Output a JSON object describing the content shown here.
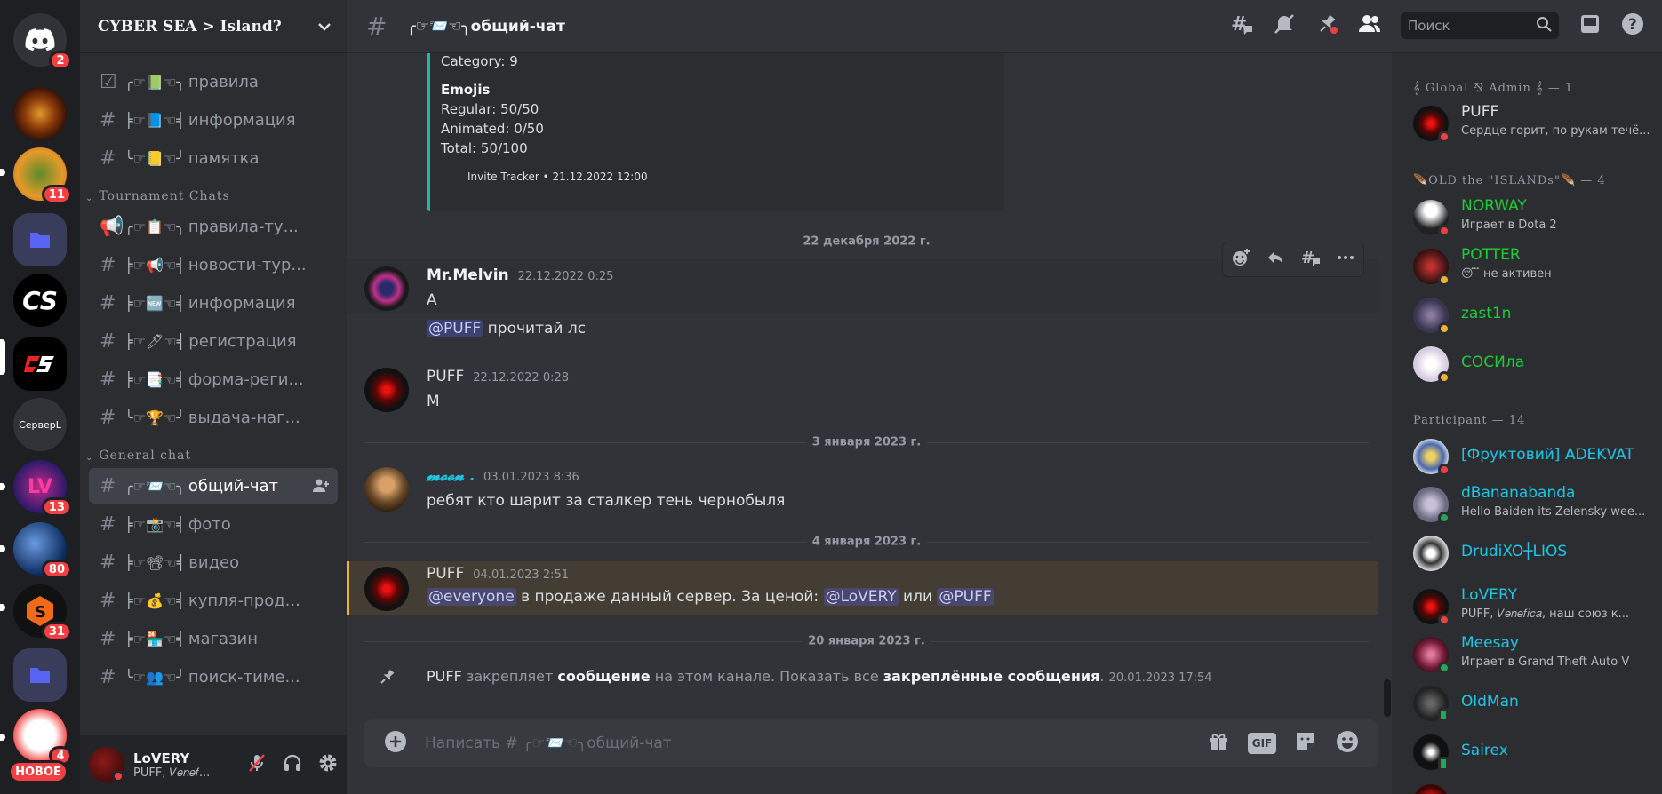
{
  "rail": {
    "home_badge": "2",
    "badges": [
      "11",
      "13",
      "80",
      "31",
      "4"
    ],
    "text_server": "СерверL",
    "new_label": "НОВОЕ"
  },
  "guild": {
    "name": "CYBER SEA > Island?"
  },
  "channels_top": [
    {
      "deco": "╭☞📗☜╮",
      "name": "правила",
      "icon": "checkbox-icon"
    },
    {
      "deco": "╞☞📘☜╡",
      "name": "информация",
      "icon": "hash-icon"
    },
    {
      "deco": "╰☞📒☜╯",
      "name": "памятка",
      "icon": "hash-lock-icon"
    }
  ],
  "category_tournament": "Tournament Chats",
  "channels_tournament": [
    {
      "deco": "╭☞📋☜╮",
      "name": "правила-ту...",
      "icon": "megaphone-icon"
    },
    {
      "deco": "╞☞📢☜╡",
      "name": "новости-тур...",
      "icon": "hash-lock-icon"
    },
    {
      "deco": "╞☞🆕☜╡",
      "name": "информация",
      "icon": "hash-lock-icon"
    },
    {
      "deco": "╞☞🖊☜╡",
      "name": "регистрация",
      "icon": "hash-lock-icon"
    },
    {
      "deco": "╞☞📑☜╡",
      "name": "форма-реги...",
      "icon": "hash-lock-icon"
    },
    {
      "deco": "╰☞🏆☜╯",
      "name": "выдача-наг...",
      "icon": "hash-lock-icon"
    }
  ],
  "category_general": "General chat",
  "channels_general": [
    {
      "deco": "╭☞📨☜╮",
      "name": "общий-чат",
      "active": true
    },
    {
      "deco": "╞☞📸☜╡",
      "name": "фото"
    },
    {
      "deco": "╞☞📽☜╡",
      "name": "видео"
    },
    {
      "deco": "╞☞💰☜╡",
      "name": "купля-прод..."
    },
    {
      "deco": "╞☞🏪☜╡",
      "name": "магазин"
    },
    {
      "deco": "╰☞👥☜╯",
      "name": "поиск-тиме..."
    }
  ],
  "user": {
    "name": "LoVERY",
    "status": "PUFF, 𝑉𝑒𝑛𝑒𝑓..."
  },
  "header": {
    "channel": "╭☞📨☜╮общий-чат",
    "search_placeholder": "Поиск"
  },
  "embed": {
    "category": "Category: 9",
    "emojis_title": "Emojis",
    "regular": "Regular: 50/50",
    "animated": "Animated: 0/50",
    "total": "Total: 50/100",
    "footer": "Invite Tracker • 21.12.2022 12:00"
  },
  "messages": {
    "divider1": "22 декабря 2022 г.",
    "m1_author": "Mr.Melvin",
    "m1_time": "22.12.2022 0:25",
    "m1_line1": "A",
    "m1_mention": "@PUFF",
    "m1_line2": " прочитай лс",
    "m2_author": "PUFF",
    "m2_time": "22.12.2022 0:28",
    "m2_line1": "M",
    "divider2": "3 января 2023 г.",
    "m3_author": "𝓶𝓸𝓸𝓷 .",
    "m3_time": "03.01.2023 8:36",
    "m3_line1": "ребят кто шарит за сталкер тень чернобыля",
    "divider3": "4 января 2023 г.",
    "m4_author": "PUFF",
    "m4_time": "04.01.2023 2:51",
    "m4_mention1": "@everyone",
    "m4_text1": " в продаже данный сервер. За ценой: ",
    "m4_mention2": "@LoVERY",
    "m4_text2": " или ",
    "m4_mention3": "@PUFF",
    "divider4": "20 января 2023 г.",
    "sys_author": "PUFF",
    "sys_text1": " закрепляет ",
    "sys_link1": "сообщение",
    "sys_text2": " на этом канале. Показать все ",
    "sys_link2": "закреплённые сообщения",
    "sys_text3": ".",
    "sys_time": "20.01.2023 17:54"
  },
  "composer": {
    "placeholder": "Написать # ╭☞📨☜╮общий-чат",
    "gif": "GIF"
  },
  "members": {
    "group1": "𝄞 Global ⅋ Admin 𝄞 — 1",
    "group2": "🪶OLD the \"ISLANDs\"🪶 — 4",
    "group3": "Participant — 14",
    "list1": [
      {
        "name": "PUFF",
        "status": "Сердце горит, по рукам течё...",
        "color": "#dbdee1",
        "st": "dnd",
        "av": "#5a0d0d"
      }
    ],
    "list2": [
      {
        "name": "NORWAY",
        "status": "Играет в Dota 2",
        "color": "#1fcc3a",
        "st": "dnd",
        "av": "#ddd"
      },
      {
        "name": "POTTER",
        "status": "😴 не активен",
        "color": "#1fcc3a",
        "st": "idle",
        "av": "#6b1e1e"
      },
      {
        "name": "zast1n",
        "status": "",
        "color": "#1fcc3a",
        "st": "idle",
        "av": "#54506e"
      },
      {
        "name": "СОСИла",
        "status": "",
        "color": "#1fcc3a",
        "st": "idle",
        "av": "#e6e0ea"
      }
    ],
    "list3": [
      {
        "name": "[Фруктовий] ADEKVAT",
        "status": "",
        "color": "#1fc7e6",
        "st": "dnd",
        "av": "#c9d3e0"
      },
      {
        "name": "dBananabanda",
        "status": "Hello Baiden its Zelensky wee...",
        "color": "#1fc7e6",
        "st": "on",
        "av": "#8a8aa0"
      },
      {
        "name": "DrudiXO┼LIOS",
        "status": "",
        "color": "#1fc7e6",
        "st": "",
        "av": "#ccc"
      },
      {
        "name": "LoVERY",
        "status": "PUFF, 𝑉𝑒𝑛𝑒𝑓𝑖𝑐𝑎, наш союз к...",
        "color": "#1fc7e6",
        "st": "dnd",
        "av": "#5a0d0d"
      },
      {
        "name": "Meesay",
        "status": "Играет в Grand Theft Auto V",
        "color": "#1fc7e6",
        "st": "on",
        "av": "#7a1e3a"
      },
      {
        "name": "OldMan",
        "status": "",
        "color": "#1fc7e6",
        "st": "mob",
        "av": "#222"
      },
      {
        "name": "Sairex",
        "status": "",
        "color": "#1fc7e6",
        "st": "mob",
        "av": "#111"
      }
    ]
  }
}
